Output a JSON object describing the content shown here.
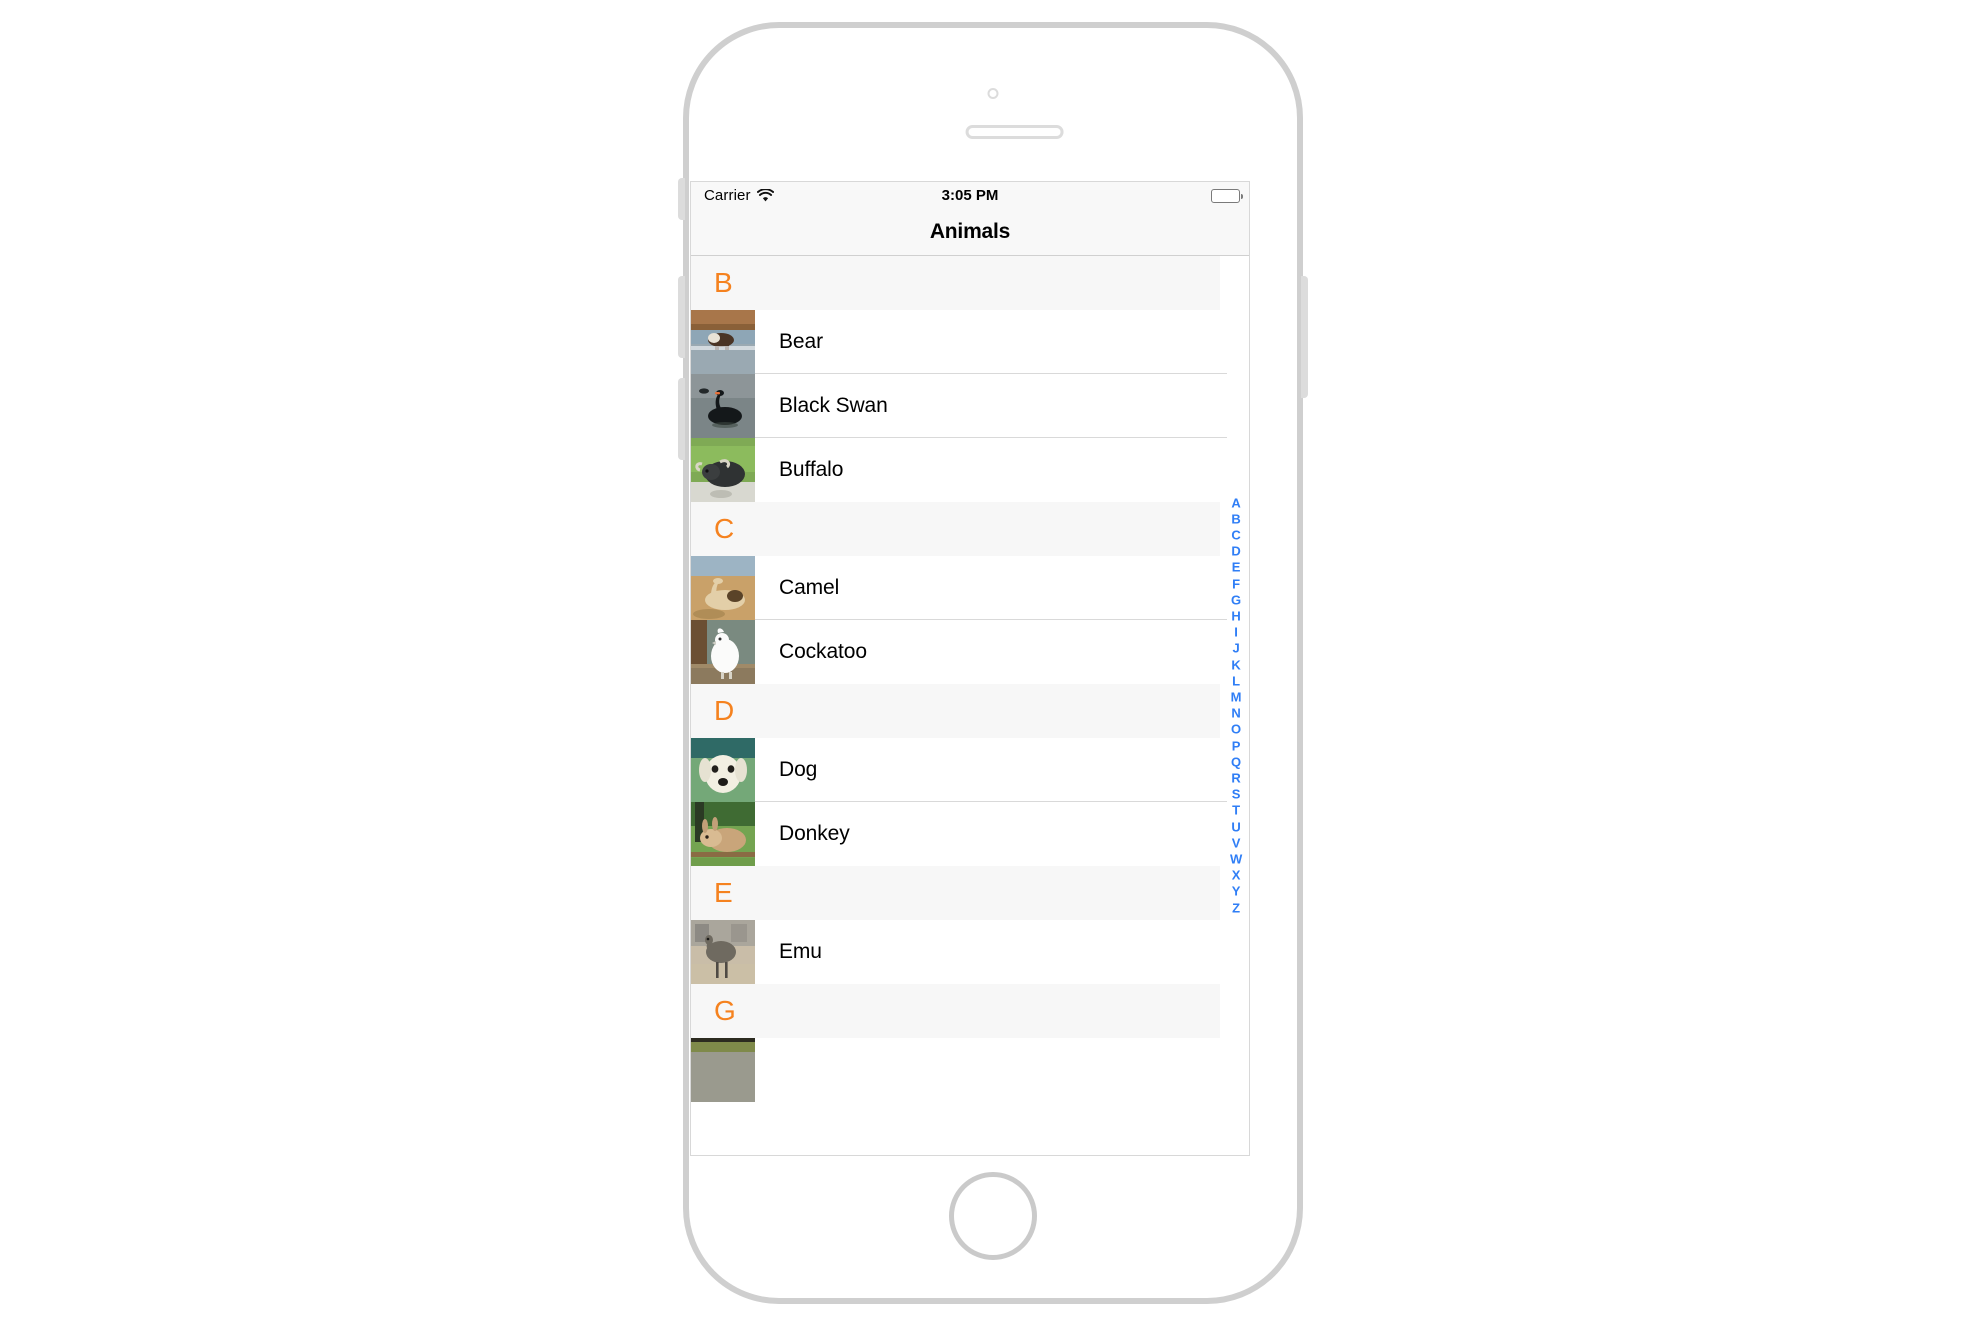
{
  "device": {
    "name": "iphone-simulator",
    "hardware": {
      "speaker": "earpiece-speaker",
      "camera": "front-camera",
      "sensor": "proximity-sensor",
      "home": "home-button",
      "buttons": [
        "mute-switch",
        "volume-up",
        "volume-down",
        "power"
      ]
    }
  },
  "status_bar": {
    "carrier": "Carrier",
    "wifi_icon": "wifi-icon",
    "time": "3:05 PM",
    "battery_icon": "battery-full-icon"
  },
  "nav_bar": {
    "title": "Animals"
  },
  "colors": {
    "section_header_text": "#F5821F",
    "index_text": "#2F7EF6",
    "separator": "#D9D9D9",
    "section_header_bg": "#F7F7F7",
    "bar_bg": "#F8F8F8",
    "frame": "#CFCFCF"
  },
  "sections": [
    {
      "letter": "B",
      "rows": [
        {
          "label": "Bear",
          "image": "bear-thumbnail"
        },
        {
          "label": "Black Swan",
          "image": "black-swan-thumbnail"
        },
        {
          "label": "Buffalo",
          "image": "buffalo-thumbnail"
        }
      ]
    },
    {
      "letter": "C",
      "rows": [
        {
          "label": "Camel",
          "image": "camel-thumbnail"
        },
        {
          "label": "Cockatoo",
          "image": "cockatoo-thumbnail"
        }
      ]
    },
    {
      "letter": "D",
      "rows": [
        {
          "label": "Dog",
          "image": "dog-thumbnail"
        },
        {
          "label": "Donkey",
          "image": "donkey-thumbnail"
        }
      ]
    },
    {
      "letter": "E",
      "rows": [
        {
          "label": "Emu",
          "image": "emu-thumbnail"
        }
      ]
    },
    {
      "letter": "G",
      "rows": []
    }
  ],
  "index_bar": {
    "letters": [
      "A",
      "B",
      "C",
      "D",
      "E",
      "F",
      "G",
      "H",
      "I",
      "J",
      "K",
      "L",
      "M",
      "N",
      "O",
      "P",
      "Q",
      "R",
      "S",
      "T",
      "U",
      "V",
      "W",
      "X",
      "Y",
      "Z"
    ]
  }
}
